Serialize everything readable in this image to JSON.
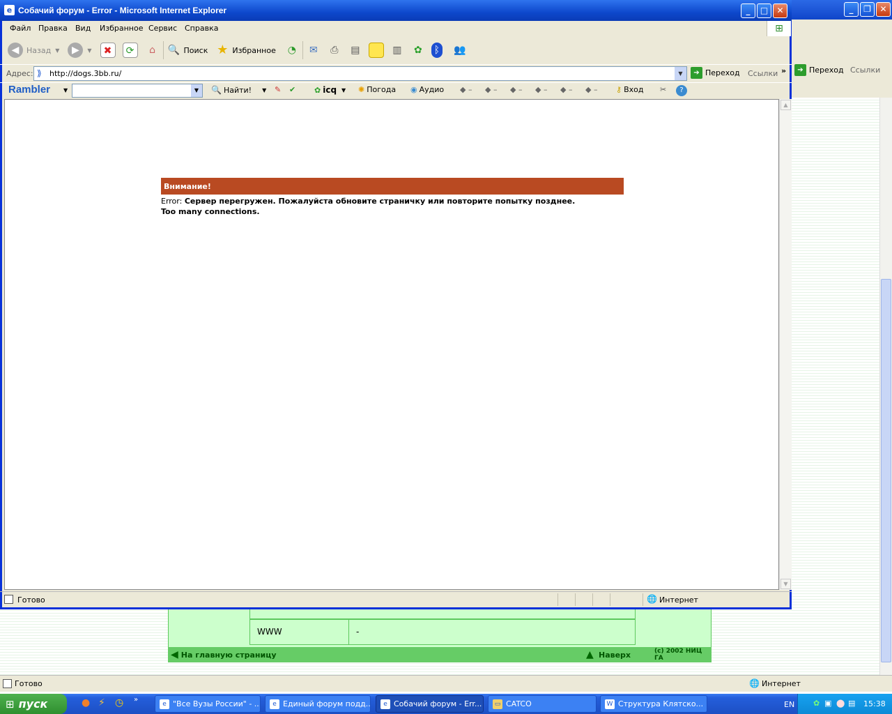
{
  "browser": {
    "title": "Собачий форум - Error - Microsoft Internet Explorer",
    "menu": [
      "Файл",
      "Правка",
      "Вид",
      "Избранное",
      "Сервис",
      "Справка"
    ],
    "toolbar": {
      "back": "Назад",
      "search": "Поиск",
      "favorites": "Избранное"
    },
    "address": {
      "label": "Адрес:",
      "url": "http://dogs.3bb.ru/",
      "go": "Переход",
      "links": "Ссылки"
    },
    "rambler": {
      "logo": "Rambler",
      "find": "Найти!",
      "icq": "icq",
      "weather": "Погода",
      "audio": "Аудио",
      "login": "Вход"
    },
    "status": {
      "text": "Готово",
      "zone": "Интернет"
    }
  },
  "page": {
    "header": "Внимание!",
    "error_label": "Error:",
    "error_text": "Сервер перегружен. Пожалуйста обновите страничку или повторите попытку позднее.",
    "error_detail": "Too many connections."
  },
  "background_window": {
    "go": "Переход",
    "links": "Ссылки",
    "status": "Готово",
    "zone": "Интернет",
    "row_label": "WWW",
    "row_value": "-",
    "nav_home": "На главную страницу",
    "nav_top": "Наверх",
    "copyright": "(c) 2002 НИЦ ГА"
  },
  "taskbar": {
    "start": "пуск",
    "tasks": [
      "\"Все Вузы России\" - ...",
      "Единый форум подд...",
      "Собачий форум - Err...",
      "CATCO",
      "Структура Клятско..."
    ],
    "lang": "EN",
    "clock": "15:38"
  }
}
